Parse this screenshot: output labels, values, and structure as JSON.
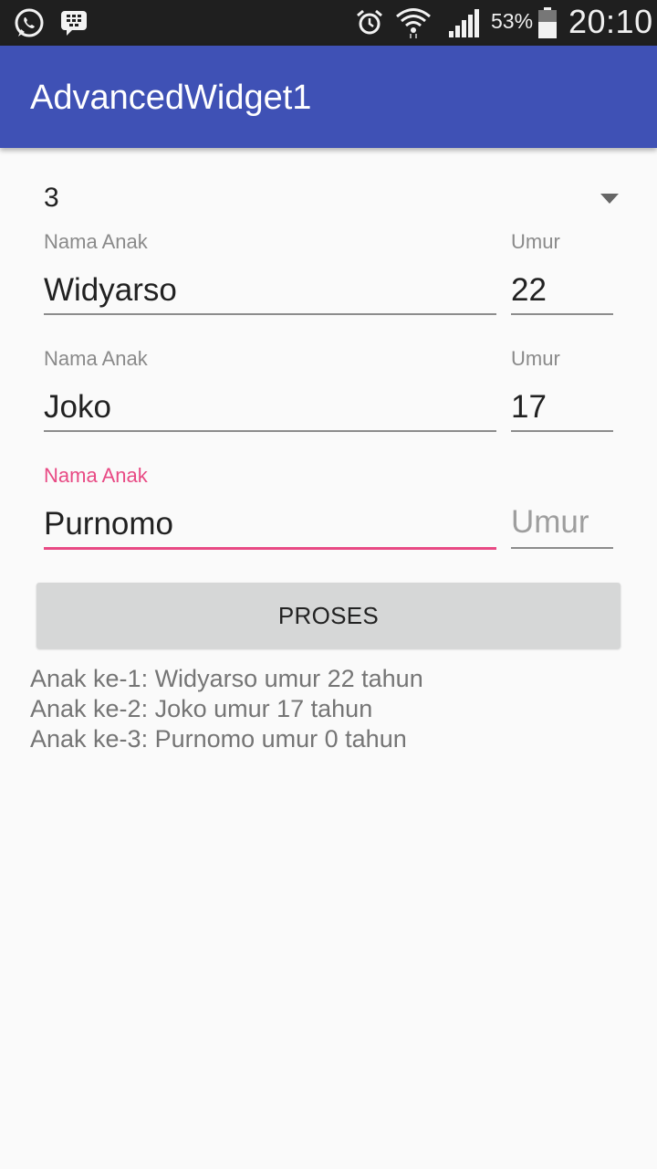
{
  "status_bar": {
    "battery_percent": "53%",
    "time": "20:10",
    "icons": [
      "whatsapp-icon",
      "bbm-icon",
      "alarm-icon",
      "wifi-icon",
      "signal-icon",
      "battery-icon"
    ]
  },
  "app_bar": {
    "title": "AdvancedWidget1"
  },
  "spinner": {
    "selected_value": "3"
  },
  "children": [
    {
      "name_label": "Nama Anak",
      "name_value": "Widyarso",
      "age_label": "Umur",
      "age_value": "22"
    },
    {
      "name_label": "Nama Anak",
      "name_value": "Joko",
      "age_label": "Umur",
      "age_value": "17"
    },
    {
      "name_label": "Nama Anak",
      "name_value": "Purnomo",
      "age_label": "",
      "age_placeholder": "Umur",
      "age_value": ""
    }
  ],
  "button": {
    "label": "PROSES"
  },
  "result_lines": [
    "Anak ke-1: Widyarso umur 22 tahun",
    "Anak ke-2: Joko umur 17 tahun",
    "Anak ke-3: Purnomo umur 0 tahun"
  ],
  "colors": {
    "primary": "#3f51b5",
    "accent": "#e84a84",
    "status_bar": "#1f1f1f",
    "background": "#fafafa"
  }
}
